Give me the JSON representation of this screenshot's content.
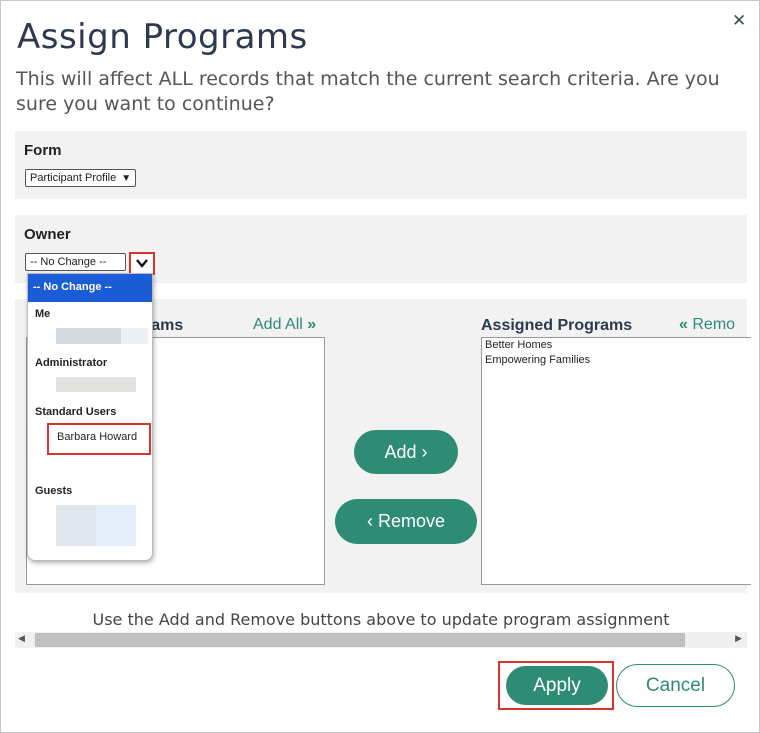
{
  "dialog": {
    "title": "Assign Programs",
    "subtitle": "This will affect ALL records that match the current search criteria. Are you sure you want to continue?",
    "close_icon": "close-icon"
  },
  "form_field": {
    "label": "Form",
    "selected": "Participant Profile"
  },
  "owner_field": {
    "label": "Owner",
    "selected": "-- No Change --"
  },
  "owner_dropdown": {
    "selected_option": "-- No Change --",
    "groups": [
      "Me",
      "Administrator",
      "Standard Users",
      "Guests"
    ],
    "highlighted_option": "Barbara Howard"
  },
  "available_programs": {
    "header_partial": "rams",
    "add_all_label": "Add All"
  },
  "assigned_programs": {
    "header": "Assigned Programs",
    "remove_all_partial": "Remo",
    "items": [
      "Better Homes",
      "Empowering Families"
    ]
  },
  "buttons": {
    "add": "Add ›",
    "remove": "‹ Remove",
    "apply": "Apply",
    "cancel": "Cancel"
  },
  "hint": "Use the Add and Remove buttons above to update program assignment",
  "colors": {
    "accent": "#2e8b74",
    "title": "#2d3a4e",
    "highlight": "#d9342b",
    "dropdown_selected": "#1a5cd6"
  }
}
